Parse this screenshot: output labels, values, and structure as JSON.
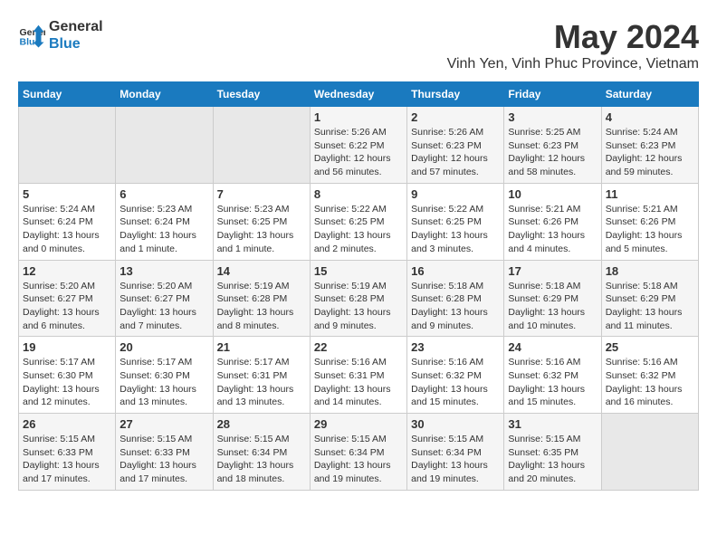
{
  "header": {
    "logo_line1": "General",
    "logo_line2": "Blue",
    "main_title": "May 2024",
    "subtitle": "Vinh Yen, Vinh Phuc Province, Vietnam"
  },
  "calendar": {
    "days_of_week": [
      "Sunday",
      "Monday",
      "Tuesday",
      "Wednesday",
      "Thursday",
      "Friday",
      "Saturday"
    ],
    "weeks": [
      [
        {
          "day": "",
          "info": ""
        },
        {
          "day": "",
          "info": ""
        },
        {
          "day": "",
          "info": ""
        },
        {
          "day": "1",
          "info": "Sunrise: 5:26 AM\nSunset: 6:22 PM\nDaylight: 12 hours\nand 56 minutes."
        },
        {
          "day": "2",
          "info": "Sunrise: 5:26 AM\nSunset: 6:23 PM\nDaylight: 12 hours\nand 57 minutes."
        },
        {
          "day": "3",
          "info": "Sunrise: 5:25 AM\nSunset: 6:23 PM\nDaylight: 12 hours\nand 58 minutes."
        },
        {
          "day": "4",
          "info": "Sunrise: 5:24 AM\nSunset: 6:23 PM\nDaylight: 12 hours\nand 59 minutes."
        }
      ],
      [
        {
          "day": "5",
          "info": "Sunrise: 5:24 AM\nSunset: 6:24 PM\nDaylight: 13 hours\nand 0 minutes."
        },
        {
          "day": "6",
          "info": "Sunrise: 5:23 AM\nSunset: 6:24 PM\nDaylight: 13 hours\nand 1 minute."
        },
        {
          "day": "7",
          "info": "Sunrise: 5:23 AM\nSunset: 6:25 PM\nDaylight: 13 hours\nand 1 minute."
        },
        {
          "day": "8",
          "info": "Sunrise: 5:22 AM\nSunset: 6:25 PM\nDaylight: 13 hours\nand 2 minutes."
        },
        {
          "day": "9",
          "info": "Sunrise: 5:22 AM\nSunset: 6:25 PM\nDaylight: 13 hours\nand 3 minutes."
        },
        {
          "day": "10",
          "info": "Sunrise: 5:21 AM\nSunset: 6:26 PM\nDaylight: 13 hours\nand 4 minutes."
        },
        {
          "day": "11",
          "info": "Sunrise: 5:21 AM\nSunset: 6:26 PM\nDaylight: 13 hours\nand 5 minutes."
        }
      ],
      [
        {
          "day": "12",
          "info": "Sunrise: 5:20 AM\nSunset: 6:27 PM\nDaylight: 13 hours\nand 6 minutes."
        },
        {
          "day": "13",
          "info": "Sunrise: 5:20 AM\nSunset: 6:27 PM\nDaylight: 13 hours\nand 7 minutes."
        },
        {
          "day": "14",
          "info": "Sunrise: 5:19 AM\nSunset: 6:28 PM\nDaylight: 13 hours\nand 8 minutes."
        },
        {
          "day": "15",
          "info": "Sunrise: 5:19 AM\nSunset: 6:28 PM\nDaylight: 13 hours\nand 9 minutes."
        },
        {
          "day": "16",
          "info": "Sunrise: 5:18 AM\nSunset: 6:28 PM\nDaylight: 13 hours\nand 9 minutes."
        },
        {
          "day": "17",
          "info": "Sunrise: 5:18 AM\nSunset: 6:29 PM\nDaylight: 13 hours\nand 10 minutes."
        },
        {
          "day": "18",
          "info": "Sunrise: 5:18 AM\nSunset: 6:29 PM\nDaylight: 13 hours\nand 11 minutes."
        }
      ],
      [
        {
          "day": "19",
          "info": "Sunrise: 5:17 AM\nSunset: 6:30 PM\nDaylight: 13 hours\nand 12 minutes."
        },
        {
          "day": "20",
          "info": "Sunrise: 5:17 AM\nSunset: 6:30 PM\nDaylight: 13 hours\nand 13 minutes."
        },
        {
          "day": "21",
          "info": "Sunrise: 5:17 AM\nSunset: 6:31 PM\nDaylight: 13 hours\nand 13 minutes."
        },
        {
          "day": "22",
          "info": "Sunrise: 5:16 AM\nSunset: 6:31 PM\nDaylight: 13 hours\nand 14 minutes."
        },
        {
          "day": "23",
          "info": "Sunrise: 5:16 AM\nSunset: 6:32 PM\nDaylight: 13 hours\nand 15 minutes."
        },
        {
          "day": "24",
          "info": "Sunrise: 5:16 AM\nSunset: 6:32 PM\nDaylight: 13 hours\nand 15 minutes."
        },
        {
          "day": "25",
          "info": "Sunrise: 5:16 AM\nSunset: 6:32 PM\nDaylight: 13 hours\nand 16 minutes."
        }
      ],
      [
        {
          "day": "26",
          "info": "Sunrise: 5:15 AM\nSunset: 6:33 PM\nDaylight: 13 hours\nand 17 minutes."
        },
        {
          "day": "27",
          "info": "Sunrise: 5:15 AM\nSunset: 6:33 PM\nDaylight: 13 hours\nand 17 minutes."
        },
        {
          "day": "28",
          "info": "Sunrise: 5:15 AM\nSunset: 6:34 PM\nDaylight: 13 hours\nand 18 minutes."
        },
        {
          "day": "29",
          "info": "Sunrise: 5:15 AM\nSunset: 6:34 PM\nDaylight: 13 hours\nand 19 minutes."
        },
        {
          "day": "30",
          "info": "Sunrise: 5:15 AM\nSunset: 6:34 PM\nDaylight: 13 hours\nand 19 minutes."
        },
        {
          "day": "31",
          "info": "Sunrise: 5:15 AM\nSunset: 6:35 PM\nDaylight: 13 hours\nand 20 minutes."
        },
        {
          "day": "",
          "info": ""
        }
      ]
    ]
  }
}
